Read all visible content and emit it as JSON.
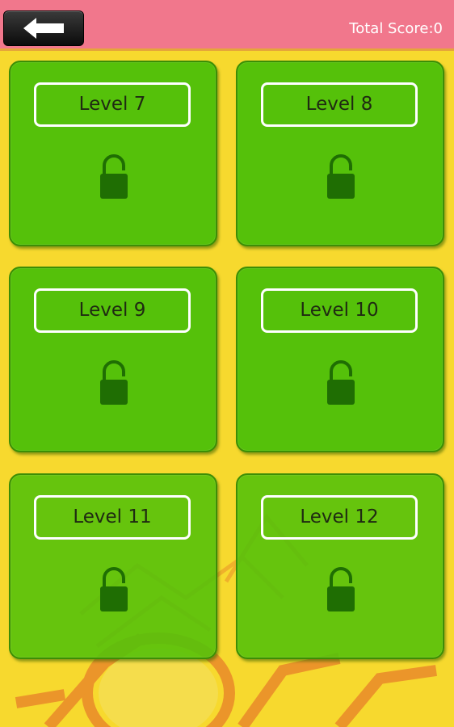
{
  "header": {
    "back_icon": "back-arrow-icon",
    "score_text": "Total Score:0"
  },
  "levels": [
    {
      "label": "Level 7",
      "icon": "lock-icon"
    },
    {
      "label": "Level 8",
      "icon": "lock-icon"
    },
    {
      "label": "Level 9",
      "icon": "lock-icon"
    },
    {
      "label": "Level 10",
      "icon": "lock-icon"
    },
    {
      "label": "Level 11",
      "icon": "lock-icon"
    },
    {
      "label": "Level 12",
      "icon": "lock-icon"
    }
  ],
  "colors": {
    "background": "#f7d92e",
    "header": "#f1778c",
    "tile": "#55c10a",
    "lock": "#1f6e03"
  }
}
